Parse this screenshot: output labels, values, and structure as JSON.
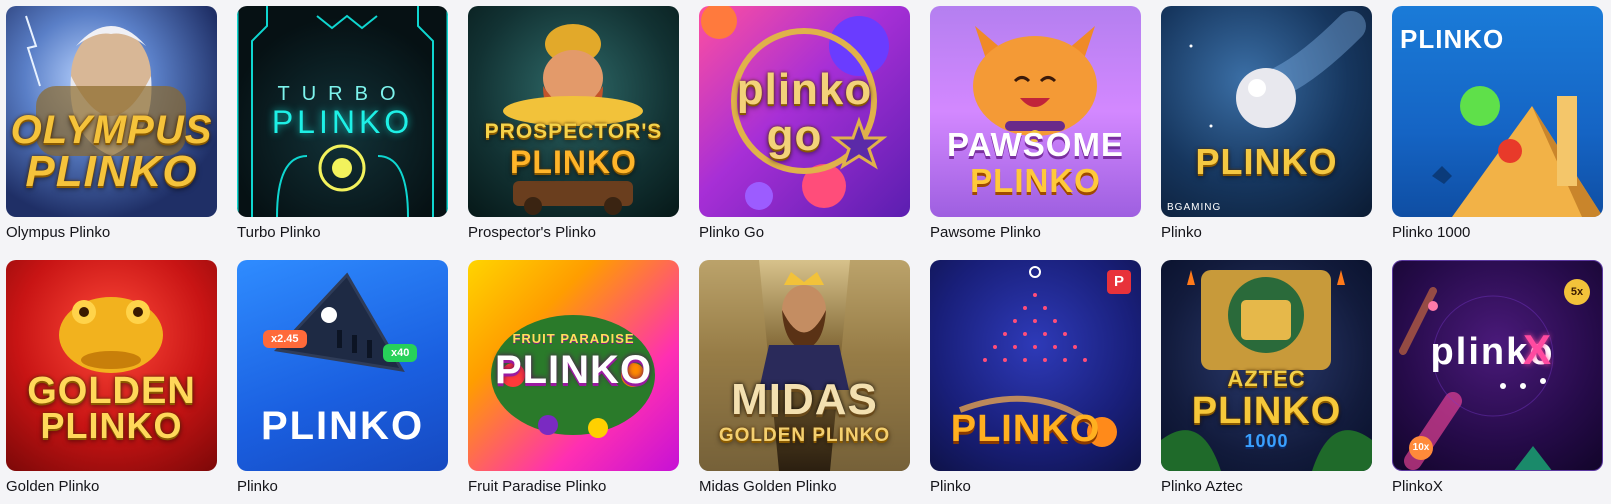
{
  "games": [
    {
      "caption": "Olympus Plinko",
      "art": [
        "OLYMPUS",
        "PLINKO"
      ]
    },
    {
      "caption": "Turbo Plinko",
      "art": [
        "TURBO",
        "PLINKO"
      ]
    },
    {
      "caption": "Prospector's Plinko",
      "art": [
        "PROSPECTOR's",
        "PLINKO"
      ]
    },
    {
      "caption": "Plinko Go",
      "art": [
        "plinko",
        "go"
      ]
    },
    {
      "caption": "Pawsome Plinko",
      "art": [
        "PAWSOME",
        "PLINKO"
      ]
    },
    {
      "caption": "Plinko",
      "art": [
        "PLINKO",
        "BGAMING"
      ]
    },
    {
      "caption": "Plinko 1000",
      "art": [
        "PLINKO"
      ]
    },
    {
      "caption": "Golden Plinko",
      "art": [
        "GOLDEN",
        "PLINKO"
      ]
    },
    {
      "caption": "Plinko",
      "art": [
        "PLINKO",
        "x2.45",
        "x40"
      ]
    },
    {
      "caption": "Fruit Paradise Plinko",
      "art": [
        "FRUIT PARADISE",
        "PLINKO"
      ]
    },
    {
      "caption": "Midas Golden Plinko",
      "art": [
        "MIDAS",
        "GOLDEN PLINKO"
      ]
    },
    {
      "caption": "Plinko",
      "art": [
        "PLINKO",
        "P"
      ]
    },
    {
      "caption": "Plinko Aztec",
      "art": [
        "AZTEC",
        "PLINKO",
        "1000"
      ]
    },
    {
      "caption": "PlinkoX",
      "art": [
        "plinko",
        "X",
        "5x",
        "10x"
      ]
    }
  ],
  "colors": {
    "page_background": "#f4f4f7",
    "caption_text": "#15151a"
  }
}
